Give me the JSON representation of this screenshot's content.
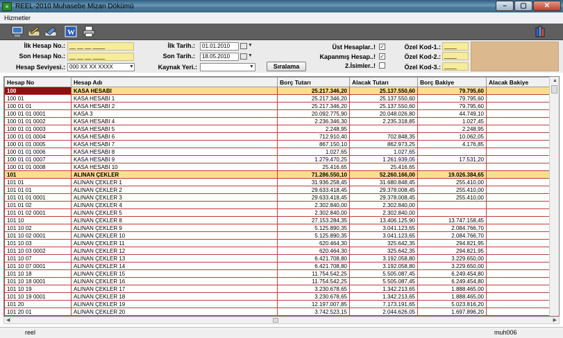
{
  "window": {
    "title": "REEL-2010 Muhasebe Mizan Dökümü",
    "icon": "app-logo-icon",
    "min": "–",
    "max": "▢",
    "close": "✕"
  },
  "menu": {
    "items": [
      "Hizmetler"
    ]
  },
  "toolbar": {
    "icons": [
      "computer-icon",
      "pencil-icon",
      "eraser-icon",
      "word-icon",
      "printer-icon",
      "books-icon"
    ]
  },
  "filters": {
    "ilk_hesap_label": "İlk Hesap No.:",
    "ilk_hesap_value": "__ __ __ ____",
    "son_hesap_label": "Son Hesap No.:",
    "son_hesap_value": "__ __ __ ____",
    "seviye_label": "Hesap Seviyesi.:",
    "seviye_value": "000 XX XX XXXX",
    "ilk_tarih_label": "İlk Tarih.:",
    "ilk_tarih_value": "01.01.2010",
    "son_tarih_label": "Son Tarih.:",
    "son_tarih_value": "18.05.2010",
    "kaynak_label": "Kaynak Yeri.:",
    "kaynak_value": "",
    "siralama_label": "Sıralama",
    "ust_hesap_label": "Üst Hesaplar..!",
    "ust_hesap_checked": "✓",
    "kapanmis_label": "Kapanmış Hesap..!",
    "kapanmis_checked": "✓",
    "isimler_label": "2.İsimler..!",
    "isimler_checked": "",
    "ozel1_label": "Özel Kod-1.:",
    "ozel1_value": "____",
    "ozel2_label": "Özel Kod-2.:",
    "ozel2_value": "____",
    "ozel3_label": "Özel Kod-3.:",
    "ozel3_value": "____"
  },
  "table": {
    "headers": [
      "Hesap No",
      "Hesap Adı",
      "Borç Tutarı",
      "Alacak Tutarı",
      "Borç Bakiye",
      "Alacak Bakiye"
    ],
    "rows": [
      {
        "no": "100",
        "ad": "KASA HESABI",
        "borc": "25.217.346,20",
        "alacak": "25.137.550,60",
        "borc_bak": "79.795,60",
        "alacak_bak": "",
        "group": true
      },
      {
        "no": "100 01",
        "ad": "KASA HESABI 1",
        "borc": "25.217.346,20",
        "alacak": "25.137.550,60",
        "borc_bak": "79.795,60",
        "alacak_bak": ""
      },
      {
        "no": "100 01 01",
        "ad": "KASA HESABI 2",
        "borc": "25.217.346,20",
        "alacak": "25.137.550,60",
        "borc_bak": "79.795,60",
        "alacak_bak": ""
      },
      {
        "no": "100 01 01 0001",
        "ad": "KASA 3",
        "borc": "20.092.775,90",
        "alacak": "20.048.026,80",
        "borc_bak": "44.749,10",
        "alacak_bak": ""
      },
      {
        "no": "100 01 01 0002",
        "ad": "KASA HESABI 4",
        "borc": "2.236.346,30",
        "alacak": "2.235.318,85",
        "borc_bak": "1.027,45",
        "alacak_bak": ""
      },
      {
        "no": "100 01 01 0003",
        "ad": "KASA HESABI 5",
        "borc": "2.248,95",
        "alacak": "",
        "borc_bak": "2.248,95",
        "alacak_bak": ""
      },
      {
        "no": "100 01 01 0004",
        "ad": "KASA HESABI 6",
        "borc": "712.910,40",
        "alacak": "702.848,35",
        "borc_bak": "10.062,05",
        "alacak_bak": ""
      },
      {
        "no": "100 01 01 0005",
        "ad": "KASA HESABI 7",
        "borc": "867.150,10",
        "alacak": "862.973,25",
        "borc_bak": "4.176,85",
        "alacak_bak": ""
      },
      {
        "no": "100 01 01 0006",
        "ad": "KASA HESABI 8",
        "borc": "1.027,65",
        "alacak": "1.027,65",
        "borc_bak": "",
        "alacak_bak": ""
      },
      {
        "no": "100 01 01 0007",
        "ad": "KASA HESABI 9",
        "borc": "1.279.470,25",
        "alacak": "1.261.939,05",
        "borc_bak": "17.531,20",
        "alacak_bak": ""
      },
      {
        "no": "100 01 01 0008",
        "ad": "KASA HESABI 10",
        "borc": "25.416,65",
        "alacak": "25.416,65",
        "borc_bak": "",
        "alacak_bak": ""
      },
      {
        "no": "101",
        "ad": "ALINAN ÇEKLER",
        "borc": "71.286.550,10",
        "alacak": "52.260.166,00",
        "borc_bak": "19.026.384,65",
        "alacak_bak": "",
        "group": true
      },
      {
        "no": "101 01",
        "ad": "ALINAN ÇEKLER 1",
        "borc": "31.936.258,45",
        "alacak": "31.680.848,45",
        "borc_bak": "255.410,00",
        "alacak_bak": ""
      },
      {
        "no": "101 01 01",
        "ad": "ALINAN ÇEKLER 2",
        "borc": "29.633.418,45",
        "alacak": "29.378.008,45",
        "borc_bak": "255.410,00",
        "alacak_bak": ""
      },
      {
        "no": "101 01 01 0001",
        "ad": "ALINAN ÇEKLER 3",
        "borc": "29.633.418,45",
        "alacak": "29.378.008,45",
        "borc_bak": "255.410,00",
        "alacak_bak": ""
      },
      {
        "no": "101 01 02",
        "ad": "ALINAN ÇEKLER 4",
        "borc": "2.302.840,00",
        "alacak": "2.302.840,00",
        "borc_bak": "",
        "alacak_bak": ""
      },
      {
        "no": "101 01 02 0001",
        "ad": "ALINAN ÇEKLER 5",
        "borc": "2.302.840,00",
        "alacak": "2.302.840,00",
        "borc_bak": "",
        "alacak_bak": ""
      },
      {
        "no": "101 10",
        "ad": "ALINAN ÇEKLER 8",
        "borc": "27.153.284,35",
        "alacak": "13.406.125,90",
        "borc_bak": "13.747.158,45",
        "alacak_bak": ""
      },
      {
        "no": "101 10 02",
        "ad": "ALINAN ÇEKLER 9",
        "borc": "5.125.890,35",
        "alacak": "3.041.123,65",
        "borc_bak": "2.084.766,70",
        "alacak_bak": ""
      },
      {
        "no": "101 10 02 0001",
        "ad": "ALINAN ÇEKLER 10",
        "borc": "5.125.890,35",
        "alacak": "3.041.123,65",
        "borc_bak": "2.084.766,70",
        "alacak_bak": ""
      },
      {
        "no": "101 10 03",
        "ad": "ALINAN ÇEKLER 11",
        "borc": "620.464,30",
        "alacak": "325.642,35",
        "borc_bak": "294.821,95",
        "alacak_bak": ""
      },
      {
        "no": "101 10 03 0002",
        "ad": "ALINAN ÇEKLER 12",
        "borc": "620.464,30",
        "alacak": "325.642,35",
        "borc_bak": "294.821,95",
        "alacak_bak": ""
      },
      {
        "no": "101 10 07",
        "ad": "ALINAN ÇEKLER 13",
        "borc": "6.421.708,80",
        "alacak": "3.192.058,80",
        "borc_bak": "3.229.650,00",
        "alacak_bak": ""
      },
      {
        "no": "101 10 07 0001",
        "ad": "ALINAN ÇEKLER 14",
        "borc": "6.421.708,80",
        "alacak": "3.192.058,80",
        "borc_bak": "3.229.650,00",
        "alacak_bak": ""
      },
      {
        "no": "101 10 18",
        "ad": "ALINAN ÇEKLER 15",
        "borc": "11.754.542,25",
        "alacak": "5.505.087,45",
        "borc_bak": "6.249.454,80",
        "alacak_bak": ""
      },
      {
        "no": "101 10 18 0001",
        "ad": "ALINAN ÇEKLER 16",
        "borc": "11.754.542,25",
        "alacak": "5.505.087,45",
        "borc_bak": "6.249.454,80",
        "alacak_bak": ""
      },
      {
        "no": "101 10 19",
        "ad": "ALINAN ÇEKLER 17",
        "borc": "3.230.678,65",
        "alacak": "1.342.213,65",
        "borc_bak": "1.888.465,00",
        "alacak_bak": ""
      },
      {
        "no": "101 10 19 0001",
        "ad": "ALINAN ÇEKLER 18",
        "borc": "3.230.678,65",
        "alacak": "1.342.213,65",
        "borc_bak": "1.888.465,00",
        "alacak_bak": ""
      },
      {
        "no": "101 20",
        "ad": "ALINAN ÇEKLER 19",
        "borc": "12.197.007,85",
        "alacak": "7.173.191,65",
        "borc_bak": "5.023.816,20",
        "alacak_bak": ""
      },
      {
        "no": "101 20 01",
        "ad": "ALINAN ÇEKLER 20",
        "borc": "3.742.523,15",
        "alacak": "2.044.626,05",
        "borc_bak": "1.697.896,20",
        "alacak_bak": ""
      }
    ]
  },
  "status": {
    "left": "reel",
    "right": "muh006"
  }
}
